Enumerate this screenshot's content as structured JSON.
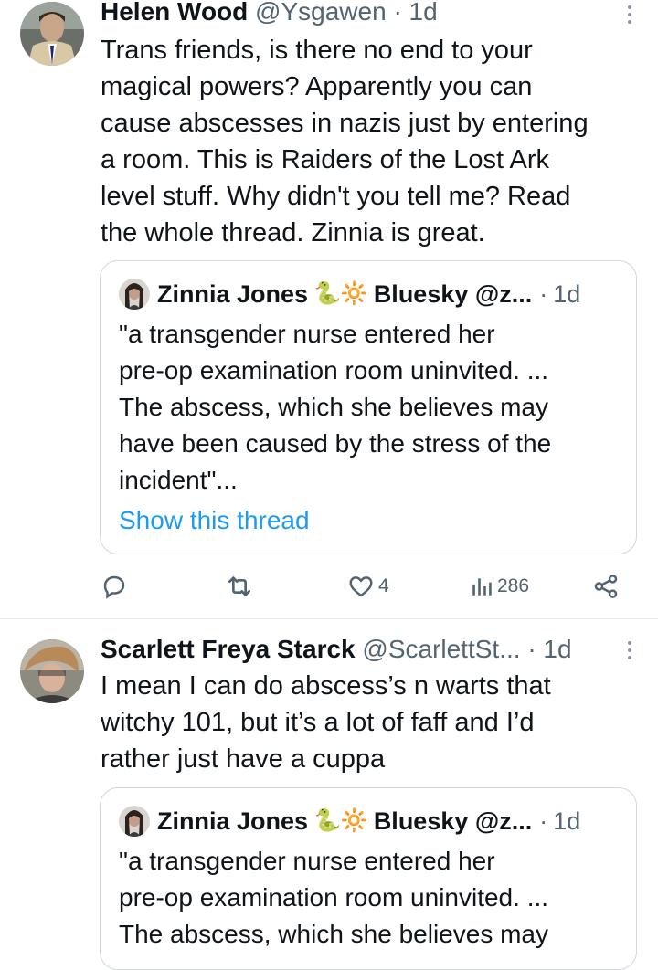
{
  "tweets": [
    {
      "author": "Helen Wood",
      "handle": "@Ysgawen",
      "sep": "·",
      "time": "1d",
      "lines": [
        "Trans friends, is there no end to your",
        "magical powers?  Apparently you can",
        "cause abscesses in nazis just by entering",
        "a room.  This is Raiders of the Lost Ark",
        "level stuff.  Why didn't you tell me?  Read",
        "the whole thread.  Zinnia is great."
      ],
      "quote": {
        "author": "Zinnia Jones",
        "emoji": "🐍🔆",
        "handle": "Bluesky @z...",
        "sep": "·",
        "time": "1d",
        "lines": [
          "\"a transgender nurse entered her",
          "pre-op examination room uninvited. ...",
          "The abscess, which she believes may",
          "have been caused by the stress of the",
          "incident\"..."
        ],
        "show_thread": "Show this thread"
      },
      "actions": {
        "reply_count": "",
        "retweet_count": "",
        "like_count": "4",
        "views_count": "286"
      }
    },
    {
      "author": "Scarlett Freya Starck",
      "handle": "@ScarlettSt...",
      "sep": "·",
      "time": "1d",
      "lines": [
        "I mean I can do abscess’s n warts that",
        "witchy 101, but it’s a lot of faff and I’d",
        "rather just have a cuppa"
      ],
      "quote": {
        "author": "Zinnia Jones",
        "emoji": "🐍🔆",
        "handle": "Bluesky @z...",
        "sep": "·",
        "time": "1d",
        "lines": [
          "\"a transgender nurse entered her",
          "pre-op examination room uninvited. ...",
          "The abscess, which she believes may"
        ]
      }
    }
  ],
  "colors": {
    "text": "#0f1419",
    "muted": "#536471",
    "link": "#1d9bf0",
    "border": "#cfd9de"
  },
  "icons": [
    "reply-icon",
    "retweet-icon",
    "like-icon",
    "views-icon",
    "share-icon",
    "more-options-icon"
  ]
}
